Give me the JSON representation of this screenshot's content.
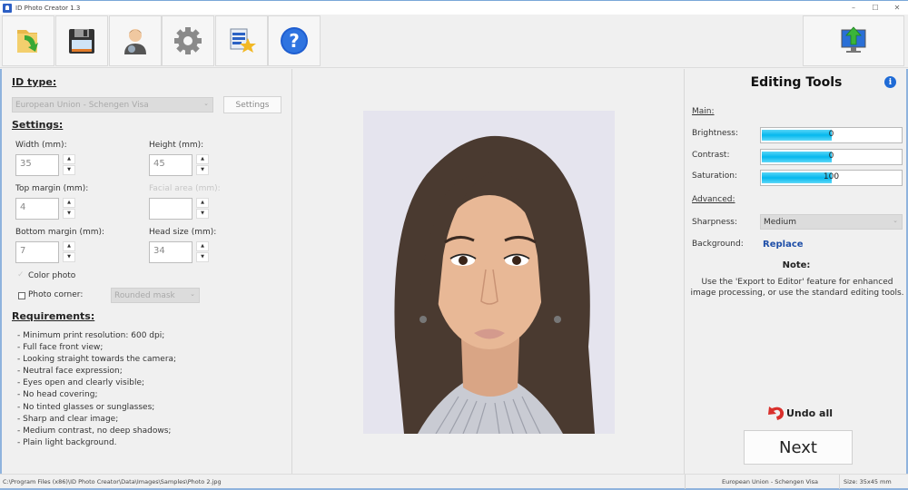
{
  "window": {
    "title": "ID Photo Creator 1.3",
    "controls": {
      "minimize": "–",
      "maximize": "☐",
      "close": "✕"
    }
  },
  "toolbar": {
    "buttons": [
      {
        "name": "open-button",
        "icon": "folder-open-icon"
      },
      {
        "name": "save-button",
        "icon": "floppy-disk-icon"
      },
      {
        "name": "user-button",
        "icon": "person-icon"
      },
      {
        "name": "settings-button",
        "icon": "gear-icon"
      },
      {
        "name": "templates-button",
        "icon": "star-document-icon"
      },
      {
        "name": "help-button",
        "icon": "question-icon"
      }
    ],
    "export_button": {
      "icon": "monitor-upload-icon"
    }
  },
  "left": {
    "id_type_title": "ID type:",
    "id_type_value": "European Union - Schengen Visa",
    "settings_button": "Settings",
    "settings_title": "Settings:",
    "width_label": "Width (mm):",
    "width_value": "35",
    "height_label": "Height (mm):",
    "height_value": "45",
    "top_margin_label": "Top margin (mm):",
    "top_margin_value": "4",
    "facial_area_label": "Facial area (mm):",
    "facial_area_value": "",
    "bottom_margin_label": "Bottom margin (mm):",
    "bottom_margin_value": "7",
    "head_size_label": "Head size (mm):",
    "head_size_value": "34",
    "color_photo_label": "Color photo",
    "color_photo_checked": true,
    "photo_corner_label": "Photo corner:",
    "photo_corner_checked": false,
    "photo_corner_value": "Rounded mask",
    "requirements_title": "Requirements:",
    "requirements": [
      "- Minimum print resolution: 600 dpi;",
      "- Full face front view;",
      "- Looking straight towards the camera;",
      "- Neutral face expression;",
      "- Eyes open and clearly visible;",
      "- No head covering;",
      "- No tinted glasses or sunglasses;",
      "- Sharp and clear image;",
      "- Medium contrast, no deep shadows;",
      "- Plain light background."
    ]
  },
  "right": {
    "title": "Editing Tools",
    "main_title": "Main:",
    "brightness_label": "Brightness:",
    "brightness_value": "0",
    "brightness_fill": 0.5,
    "contrast_label": "Contrast:",
    "contrast_value": "0",
    "contrast_fill": 0.5,
    "saturation_label": "Saturation:",
    "saturation_value": "100",
    "saturation_fill": 0.5,
    "advanced_title": "Advanced:",
    "sharpness_label": "Sharpness:",
    "sharpness_value": "Medium",
    "background_label": "Background:",
    "background_link": "Replace",
    "note_title": "Note:",
    "note_text": "Use the 'Export to Editor' feature for enhanced image processing, or use the standard editing tools.",
    "undo_label": "Undo all",
    "next_label": "Next"
  },
  "status": {
    "path": "C:\\Program Files (x86)\\ID Photo Creator\\Data\\Images\\Samples\\Photo 2.jpg",
    "id_type": "European Union - Schengen Visa",
    "size": "Size: 35x45 mm"
  },
  "colors": {
    "accent_border": "#8fb3dd",
    "slider_fill": "#05b8ee",
    "link": "#1f4fa8"
  }
}
